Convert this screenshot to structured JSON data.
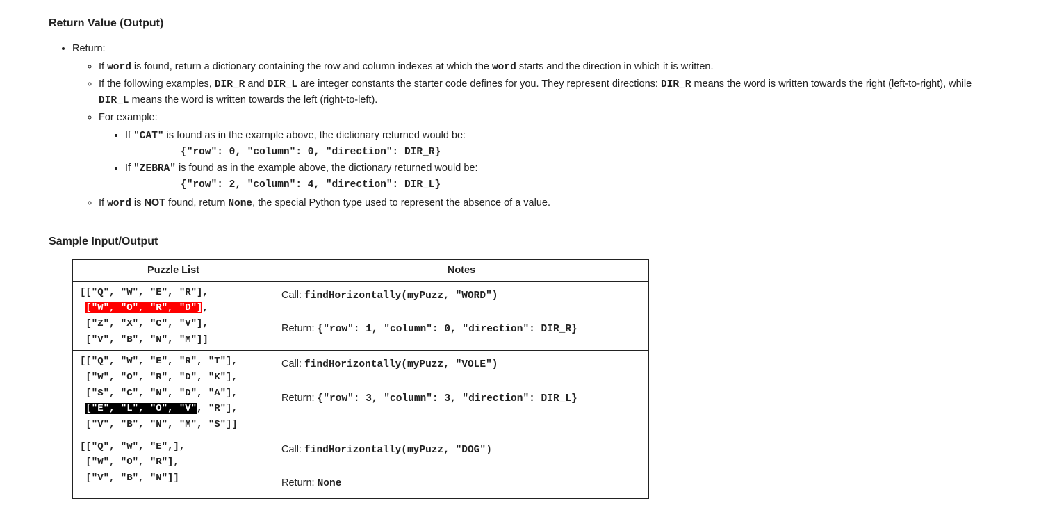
{
  "section1": {
    "heading": "Return Value (Output)",
    "bullet_return": "Return:",
    "sub1_pre": "If ",
    "sub1_word": "word",
    "sub1_mid": " is found, return a dictionary containing the row and column indexes at which the ",
    "sub1_word2": "word",
    "sub1_post": " starts and the direction in which it is written.",
    "sub2_pre": "If the following examples, ",
    "sub2_dirr": "DIR_R",
    "sub2_and": " and ",
    "sub2_dirl": "DIR_L",
    "sub2_mid": " are integer constants the starter code defines for you. They represent directions: ",
    "sub2_dirr2": "DIR_R",
    "sub2_mid2": " means the word is written towards the right (left-to-right), while ",
    "sub2_dirl2": "DIR_L",
    "sub2_post": " means the word is written towards the left (right-to-left).",
    "sub3": "For example:",
    "ex1_pre": "If ",
    "ex1_word": "\"CAT\"",
    "ex1_post": " is found as in the example above, the dictionary returned would be:",
    "ex1_code": "{\"row\": 0, \"column\": 0, \"direction\": DIR_R}",
    "ex2_pre": "If ",
    "ex2_word": "\"ZEBRA\"",
    "ex2_post": " is found as in the example above, the dictionary returned would be:",
    "ex2_code": "{\"row\": 2, \"column\": 4, \"direction\": DIR_L}",
    "sub4_pre": "If ",
    "sub4_word": "word",
    "sub4_is": " is ",
    "sub4_not": "NOT",
    "sub4_found": " found, return ",
    "sub4_none": "None",
    "sub4_post": ", the special Python type used to represent the absence of a value."
  },
  "section2": {
    "heading": "Sample Input/Output",
    "col1": "Puzzle List",
    "col2": "Notes",
    "rows": [
      {
        "puzzle_segments": [
          {
            "t": "[[\"Q\", \"W\", \"E\", \"R\"],\n ",
            "c": ""
          },
          {
            "t": "[\"W\", \"O\", \"R\", \"D\"]",
            "c": "hl-red"
          },
          {
            "t": ",\n [\"Z\", \"X\", \"C\", \"V\"],\n [\"V\", \"B\", \"N\", \"M\"]]",
            "c": ""
          }
        ],
        "call_label": "Call: ",
        "call_code": "findHorizontally(myPuzz, \"WORD\")",
        "return_label": "Return: ",
        "return_code": "{\"row\": 1, \"column\": 0, \"direction\": DIR_R}"
      },
      {
        "puzzle_segments": [
          {
            "t": "[[\"Q\", \"W\", \"E\", \"R\", \"T\"],\n [\"W\", \"O\", \"R\", \"D\", \"K\"],\n [\"S\", \"C\", \"N\", \"D\", \"A\"],\n ",
            "c": ""
          },
          {
            "t": "[\"E\", \"L\", \"O\", \"V\"",
            "c": "hl-black"
          },
          {
            "t": ", \"R\"],\n [\"V\", \"B\", \"N\", \"M\", \"S\"]]",
            "c": ""
          }
        ],
        "call_label": "Call: ",
        "call_code": "findHorizontally(myPuzz, \"VOLE\")",
        "return_label": "Return: ",
        "return_code": "{\"row\": 3, \"column\": 3, \"direction\": DIR_L}"
      },
      {
        "puzzle_segments": [
          {
            "t": "[[\"Q\", \"W\", \"E\",],\n [\"W\", \"O\", \"R\"],\n [\"V\", \"B\", \"N\"]]",
            "c": ""
          }
        ],
        "call_label": "Call: ",
        "call_code": "findHorizontally(myPuzz, \"DOG\")",
        "return_label": "Return: ",
        "return_code": "None"
      }
    ]
  }
}
